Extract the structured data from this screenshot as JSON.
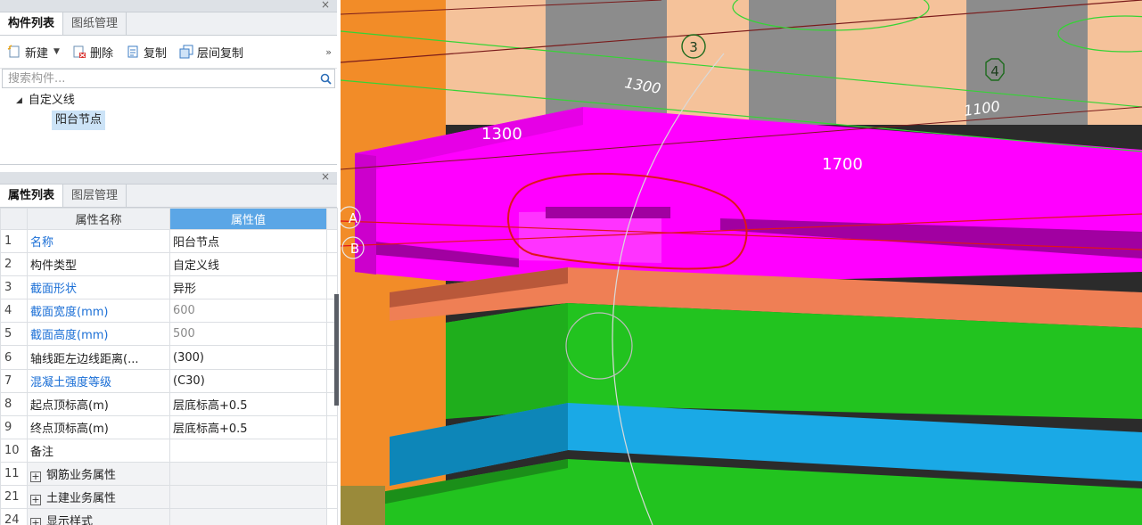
{
  "component_panel": {
    "close_glyph": "×",
    "tabs": [
      {
        "label": "构件列表",
        "active": true
      },
      {
        "label": "图纸管理",
        "active": false
      }
    ],
    "toolbar": {
      "new_label": "新建",
      "delete_label": "删除",
      "copy_label": "复制",
      "floor_copy_label": "层间复制",
      "more_glyph": "»"
    },
    "search": {
      "placeholder": "搜索构件..."
    },
    "tree": {
      "parent_label": "自定义线",
      "child_label": "阳台节点"
    }
  },
  "property_panel": {
    "close_glyph": "×",
    "tabs": [
      {
        "label": "属性列表",
        "active": true
      },
      {
        "label": "图层管理",
        "active": false
      }
    ],
    "headers": {
      "name": "属性名称",
      "value": "属性值"
    },
    "rows": [
      {
        "num": "1",
        "name": "名称",
        "value": "阳台节点",
        "name_color": "blue",
        "value_color": "normal"
      },
      {
        "num": "2",
        "name": "构件类型",
        "value": "自定义线",
        "name_color": "normal",
        "value_color": "normal"
      },
      {
        "num": "3",
        "name": "截面形状",
        "value": "异形",
        "name_color": "blue",
        "value_color": "normal"
      },
      {
        "num": "4",
        "name": "截面宽度(mm)",
        "value": "600",
        "name_color": "blue",
        "value_color": "gray"
      },
      {
        "num": "5",
        "name": "截面高度(mm)",
        "value": "500",
        "name_color": "blue",
        "value_color": "gray"
      },
      {
        "num": "6",
        "name": "轴线距左边线距离(...",
        "value": "(300)",
        "name_color": "normal",
        "value_color": "normal"
      },
      {
        "num": "7",
        "name": "混凝土强度等级",
        "value": "(C30)",
        "name_color": "blue",
        "value_color": "normal"
      },
      {
        "num": "8",
        "name": "起点顶标高(m)",
        "value": "层底标高+0.5",
        "name_color": "normal",
        "value_color": "normal"
      },
      {
        "num": "9",
        "name": "终点顶标高(m)",
        "value": "层底标高+0.5",
        "name_color": "normal",
        "value_color": "normal"
      },
      {
        "num": "10",
        "name": "备注",
        "value": "",
        "name_color": "normal",
        "value_color": "normal"
      }
    ],
    "groups": [
      {
        "num": "11",
        "label": "钢筋业务属性",
        "toggle": "+"
      },
      {
        "num": "21",
        "label": "土建业务属性",
        "toggle": "+"
      },
      {
        "num": "24",
        "label": "显示样式",
        "toggle": "+"
      }
    ]
  },
  "viewport": {
    "axis_labels": [
      "3",
      "4",
      "A",
      "B"
    ],
    "dimensions": [
      "1300",
      "1700",
      "1300",
      "1100"
    ],
    "colors": {
      "orange": "#f28c28",
      "peach": "#f5c29a",
      "gray": "#8c8c8c",
      "magenta": "#ff00ff",
      "salmon": "#ef7f55",
      "green": "#22c31f",
      "cyan": "#1aa9e6",
      "red_outline": "#e0141b"
    }
  }
}
